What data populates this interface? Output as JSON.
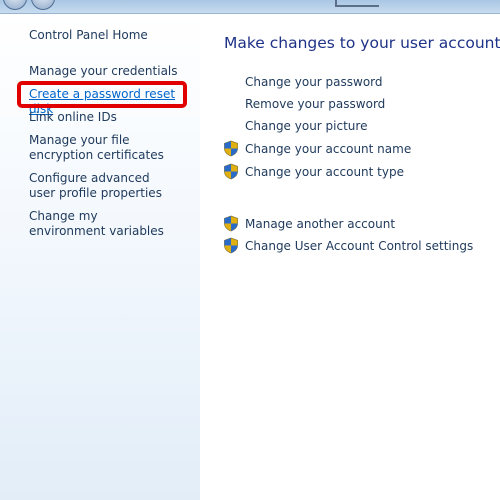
{
  "sidebar": {
    "home": "Control Panel Home",
    "links": [
      "Manage your credentials",
      "Create a password reset disk",
      "Link online IDs",
      "Manage your file encryption certificates",
      "Configure advanced user profile properties",
      "Change my environment variables"
    ]
  },
  "main": {
    "title": "Make changes to your user account",
    "tasks": [
      {
        "label": "Change your password",
        "icon": "none"
      },
      {
        "label": "Remove your password",
        "icon": "none"
      },
      {
        "label": "Change your picture",
        "icon": "none"
      },
      {
        "label": "Change your account name",
        "icon": "uac-shield-icon"
      },
      {
        "label": "Change your account type",
        "icon": "uac-shield-icon"
      },
      {
        "label": "Manage another account",
        "icon": "uac-shield-icon"
      },
      {
        "label": "Change User Account Control settings",
        "icon": "uac-shield-icon"
      }
    ]
  },
  "colors": {
    "link": "#1e395b",
    "title": "#1e3287",
    "highlight_box": "#e00000",
    "highlighted_link": "#0066cc"
  }
}
